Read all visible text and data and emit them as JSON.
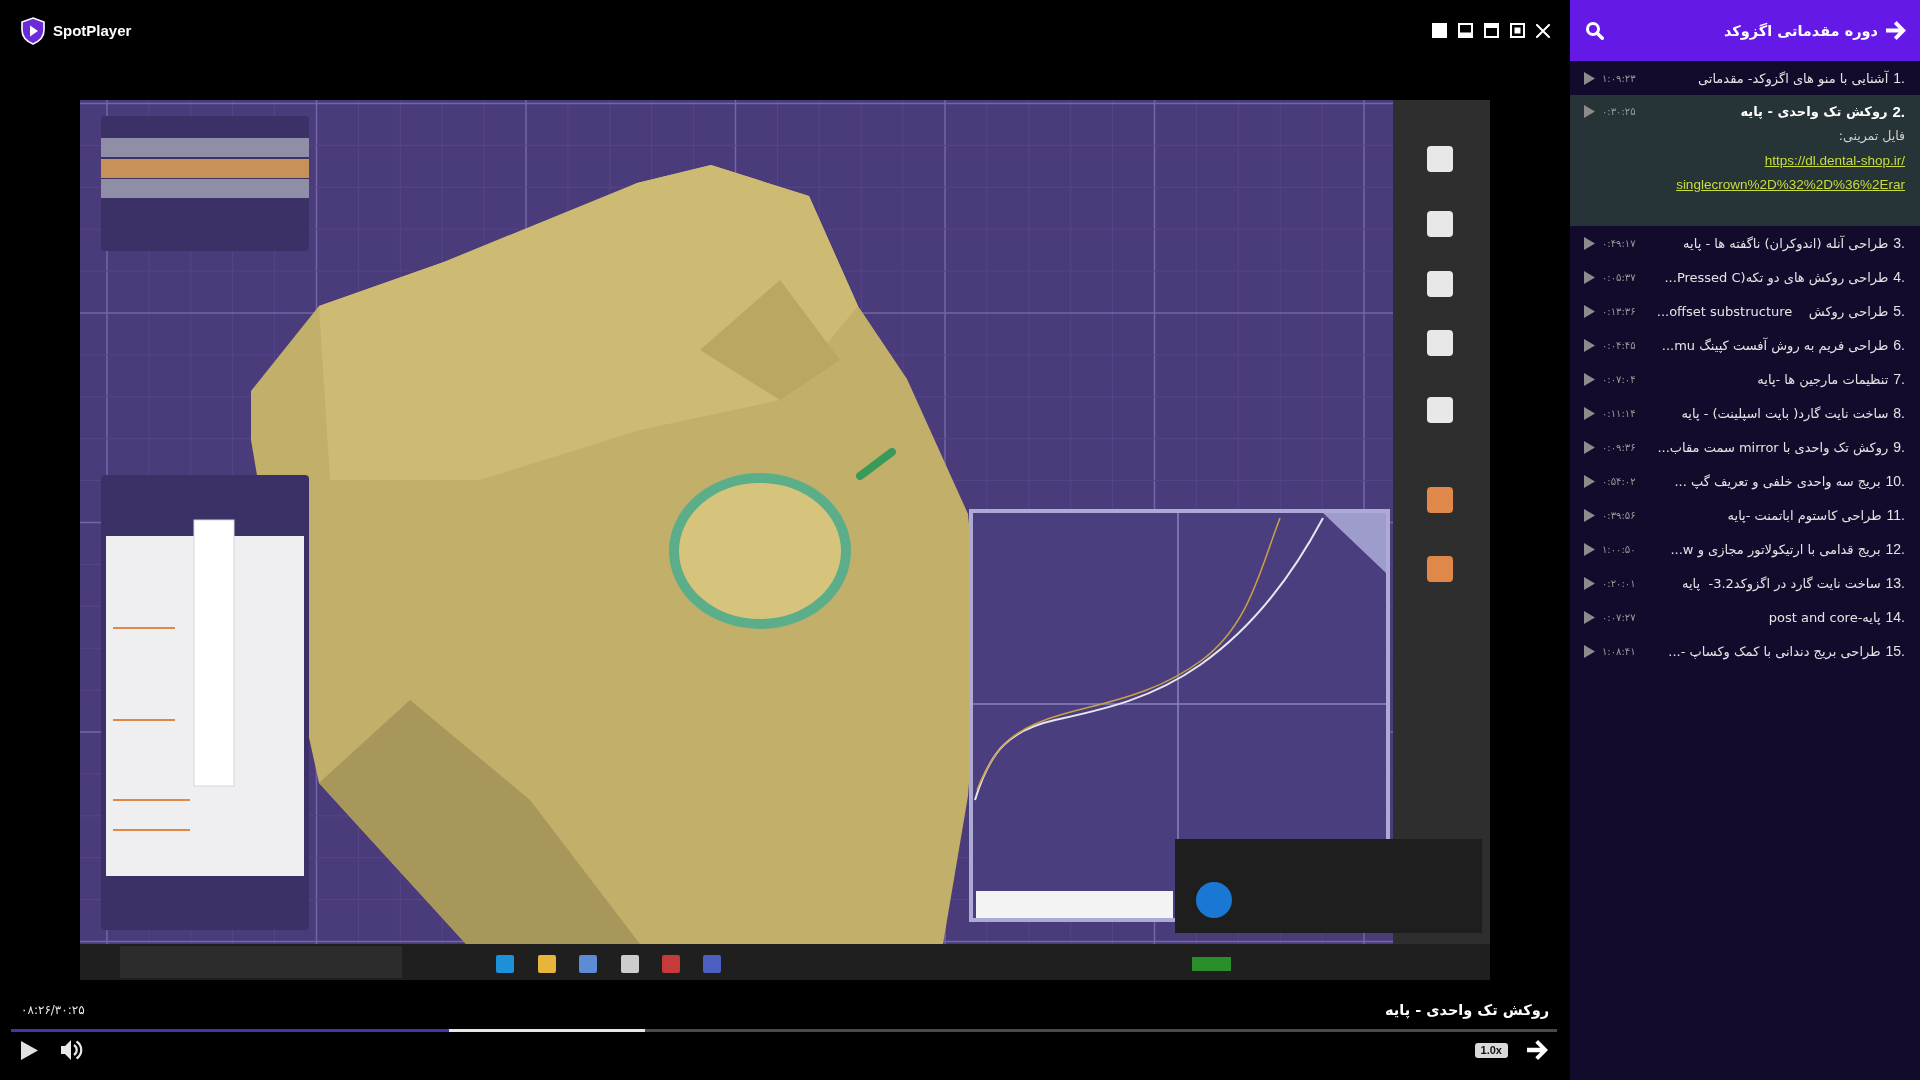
{
  "app": {
    "name": "SpotPlayer"
  },
  "player": {
    "time": "۰۸:۲۶/۳۰:۲۵",
    "title": "روکش تک واحدی - پایه",
    "progress": {
      "level": 0.283
    },
    "buffer": {
      "level": 0.41
    },
    "speed": "1.0x"
  },
  "playlist": {
    "title": "دوره مقدماتی اگزوکد",
    "items": [
      {
        "number": "1.",
        "title": "آشنایی با منو های اگزوکد- مقدماتی",
        "duration": "۱:۰۹:۲۳",
        "selected": false
      },
      {
        "number": "2.",
        "title": "روکش تک واحدی - پایه",
        "duration": "۰:۳۰:۲۵",
        "selected": true,
        "note": "فایل تمرینی:",
        "link_lines": [
          "https://dl.dental-shop.ir/",
          "singlecrown%2D%32%2D%36%2Erar"
        ]
      },
      {
        "number": "3.",
        "title": "طراحی آنله (اندوکران) ناگفته ها - پایه",
        "duration": "۰:۴۹:۱۷",
        "selected": false
      },
      {
        "number": "4.",
        "title": "طراحی روکش های دو تکه(Pressed C...",
        "duration": "۰:۰۵:۳۷",
        "selected": false
      },
      {
        "number": "5.",
        "title": "طراحی روکش    offset substructure...",
        "duration": "۰:۱۳:۳۶",
        "selected": false
      },
      {
        "number": "6.",
        "title": "طراحی فریم به روش آفست کپینگ mu...",
        "duration": "۰:۰۴:۴۵",
        "selected": false
      },
      {
        "number": "7.",
        "title": "تنظیمات مارجین ها -پایه",
        "duration": "۰:۰۷:۰۴",
        "selected": false
      },
      {
        "number": "8.",
        "title": "ساخت نایت گارد( بایت اسپلینت) - پایه",
        "duration": "۰:۱۱:۱۴",
        "selected": false
      },
      {
        "number": "9.",
        "title": "روکش تک واحدی با mirror سمت مقاب...",
        "duration": "۰:۰۹:۳۶",
        "selected": false
      },
      {
        "number": "10.",
        "title": "بریج سه واحدی خلفی و تعریف گپ ...",
        "duration": "۰:۵۴:۰۲",
        "selected": false
      },
      {
        "number": "11.",
        "title": "طراحی کاستوم اباتمنت -پایه",
        "duration": "۰:۳۹:۵۶",
        "selected": false
      },
      {
        "number": "12.",
        "title": "بریج قدامی با ارتیکولاتور مجازی و w...",
        "duration": "۱:۰۰:۵۰",
        "selected": false
      },
      {
        "number": "13.",
        "title": "ساخت نایت گارد در اگزوکد3.2-  پایه",
        "duration": "۰:۲۰:۰۱",
        "selected": false
      },
      {
        "number": "14.",
        "title": "پایه-post and core",
        "duration": "۰:۰۷:۲۷",
        "selected": false
      },
      {
        "number": "15.",
        "title": "طراحی بریج دندانی با کمک وکساپ -...",
        "duration": "۱:۰۸:۴۱",
        "selected": false
      }
    ]
  }
}
